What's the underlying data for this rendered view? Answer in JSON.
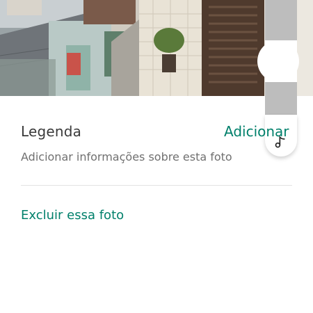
{
  "photo": {
    "alt_icon": "photo-image"
  },
  "caption": {
    "label": "Legenda",
    "add_label": "Adicionar",
    "description": "Adicionar informações sobre esta foto"
  },
  "actions": {
    "delete_label": "Excluir essa foto"
  },
  "side_widget": {
    "icon": "music-note-icon"
  },
  "colors": {
    "accent": "#00806b",
    "label_text": "#3a3a3a",
    "secondary_text": "#707070",
    "divider": "#e2e2e2"
  }
}
